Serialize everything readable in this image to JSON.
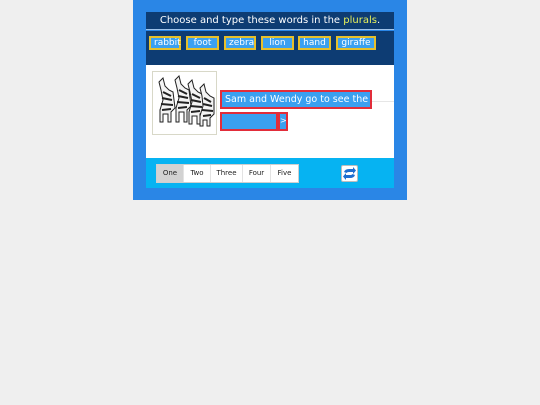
{
  "header": {
    "prefix": "Choose and type these words in the ",
    "highlight": "plurals",
    "suffix": "."
  },
  "words": [
    "rabbit",
    "foot",
    "zebra",
    "lion",
    "hand",
    "giraffe"
  ],
  "sentence": "Sam and Wendy go to see the",
  "answer_value": "",
  "answer_button": ">",
  "tabs": [
    "One",
    "Two",
    "Three",
    "Four",
    "Five"
  ],
  "active_tab": "One",
  "picture": {
    "icon": "zebras-image"
  },
  "refresh": {
    "icon": "refresh-icon"
  },
  "colors": {
    "frame": "#2a86e6",
    "header": "#0d3c73",
    "word_bg": "#3aa0f0",
    "word_border": "#e6c02a",
    "highlight": "#e8f05a",
    "input_border": "#e22d3a",
    "bottom_bar": "#06b3f2"
  }
}
